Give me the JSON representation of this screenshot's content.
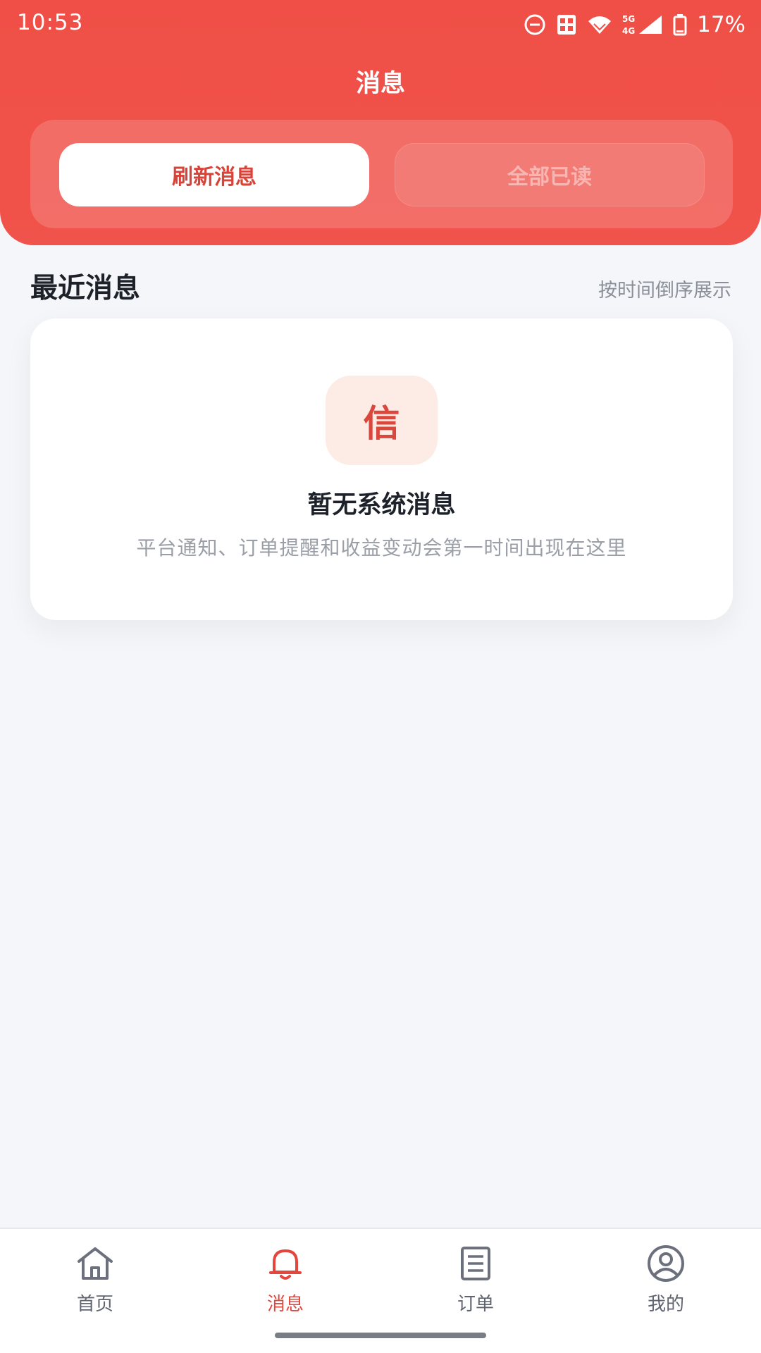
{
  "status_bar": {
    "time": "10:53",
    "battery": "17%",
    "network": "5G 4G",
    "icons": [
      "dnd-icon",
      "sim-icon",
      "wifi-icon",
      "signal-icon",
      "battery-icon"
    ]
  },
  "header": {
    "title": "消息",
    "buttons": {
      "refresh": "刷新消息",
      "read_all": "全部已读"
    }
  },
  "section": {
    "title": "最近消息",
    "hint": "按时间倒序展示"
  },
  "empty_state": {
    "icon_char": "信",
    "title": "暂无系统消息",
    "description": "平台通知、订单提醒和收益变动会第一时间出现在这里"
  },
  "bottom_nav": {
    "items": [
      {
        "label": "首页",
        "icon": "home-icon",
        "active": false
      },
      {
        "label": "消息",
        "icon": "bell-icon",
        "active": true
      },
      {
        "label": "订单",
        "icon": "document-icon",
        "active": false
      },
      {
        "label": "我的",
        "icon": "user-icon",
        "active": false
      }
    ]
  },
  "colors": {
    "primary": "#ef4f46",
    "active_nav": "#e3463c",
    "inactive_nav": "#5f6470",
    "background": "#f5f6f9"
  }
}
